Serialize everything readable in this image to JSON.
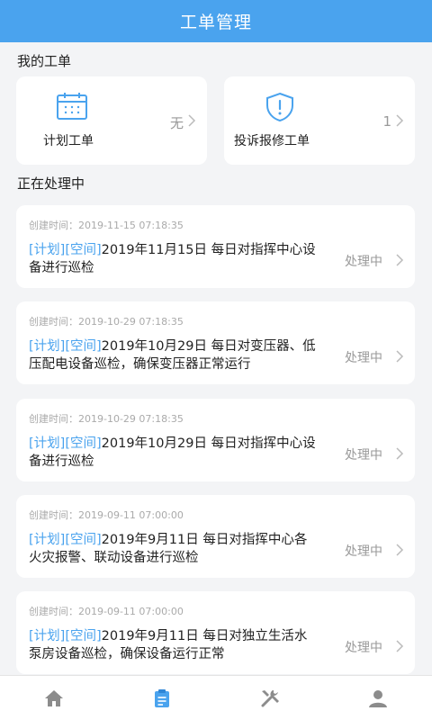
{
  "header": {
    "title": "工单管理"
  },
  "my_orders": {
    "section_title": "我的工单",
    "cards": [
      {
        "label": "计划工单",
        "count": "无",
        "icon": "calendar-icon"
      },
      {
        "label": "投诉报修工单",
        "count": "1",
        "icon": "shield-alert-icon"
      }
    ]
  },
  "processing": {
    "section_title": "正在处理中",
    "items": [
      {
        "time": "创建时间：2019-11-15 07:18:35",
        "tag1": "[计划]",
        "tag2": "[空间]",
        "title": "2019年11月15日 每日对指挥中心设备进行巡检",
        "status": "处理中"
      },
      {
        "time": "创建时间：2019-10-29 07:18:35",
        "tag1": "[计划]",
        "tag2": "[空间]",
        "title": "2019年10月29日 每日对变压器、低压配电设备巡检，确保变压器正常运行",
        "status": "处理中"
      },
      {
        "time": "创建时间：2019-10-29 07:18:35",
        "tag1": "[计划]",
        "tag2": "[空间]",
        "title": "2019年10月29日 每日对指挥中心设备进行巡检",
        "status": "处理中"
      },
      {
        "time": "创建时间：2019-09-11 07:00:00",
        "tag1": "[计划]",
        "tag2": "[空间]",
        "title": "2019年9月11日 每日对指挥中心各火灾报警、联动设备进行巡检",
        "status": "处理中"
      },
      {
        "time": "创建时间：2019-09-11 07:00:00",
        "tag1": "[计划]",
        "tag2": "[空间]",
        "title": "2019年9月11日 每日对独立生活水泵房设备巡检，确保设备运行正常",
        "status": "处理中"
      }
    ]
  },
  "tabbar": {
    "active": 1,
    "tabs": [
      {
        "icon": "home-icon"
      },
      {
        "icon": "clipboard-icon"
      },
      {
        "icon": "tools-icon"
      },
      {
        "icon": "user-icon"
      }
    ]
  },
  "colors": {
    "accent": "#4aa3ee",
    "muted": "#999999",
    "background": "#f3f4f6"
  }
}
